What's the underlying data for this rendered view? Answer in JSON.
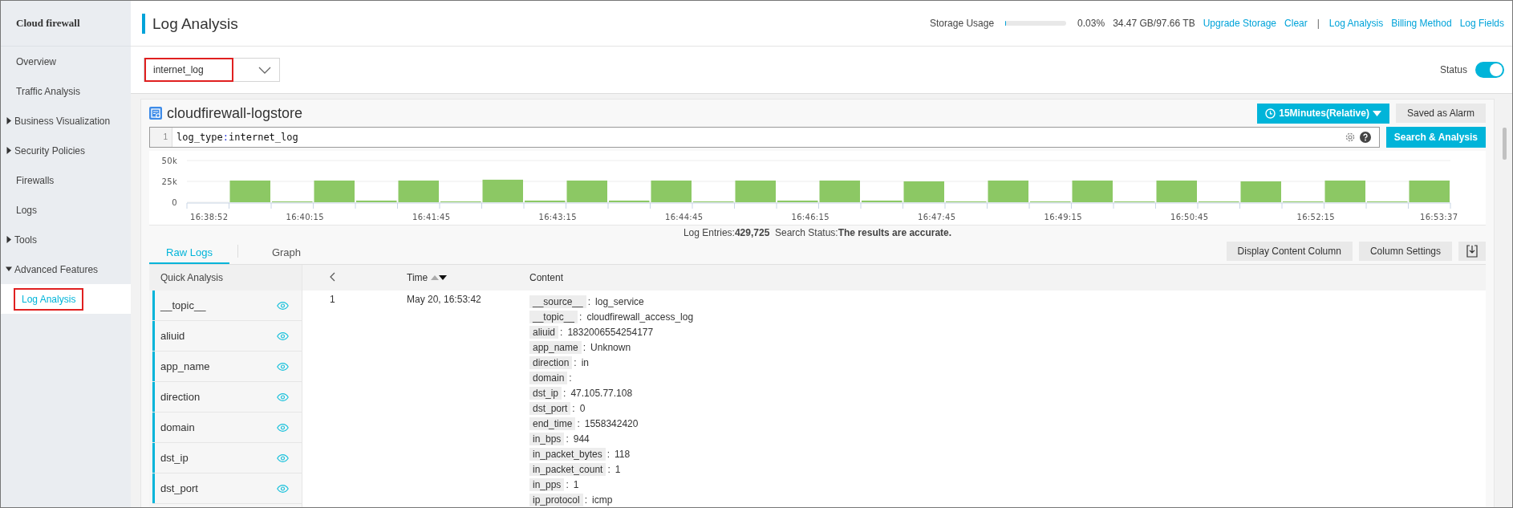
{
  "sidebar": {
    "title": "Cloud firewall",
    "items": [
      {
        "label": "Overview",
        "kind": "link",
        "selected": false
      },
      {
        "label": "Traffic Analysis",
        "kind": "link",
        "selected": false
      },
      {
        "label": "Business Visualization",
        "kind": "group",
        "expanded": false
      },
      {
        "label": "Security Policies",
        "kind": "group",
        "expanded": false
      },
      {
        "label": "Firewalls",
        "kind": "link",
        "selected": false
      },
      {
        "label": "Logs",
        "kind": "link",
        "selected": false
      },
      {
        "label": "Tools",
        "kind": "group",
        "expanded": false
      },
      {
        "label": "Advanced Features",
        "kind": "group",
        "expanded": true,
        "children": [
          {
            "label": "Log Analysis",
            "selected": true,
            "highlighted": true
          }
        ]
      }
    ]
  },
  "header": {
    "title": "Log Analysis",
    "storage": {
      "label": "Storage Usage",
      "level": 0.0003,
      "percent": "0.03%",
      "amount": "34.47 GB/97.66 TB"
    },
    "links": [
      {
        "kind": "link",
        "label": "Upgrade Storage"
      },
      {
        "kind": "link",
        "label": "Clear"
      },
      {
        "kind": "separator",
        "label": "|"
      },
      {
        "kind": "link",
        "label": "Log Analysis"
      },
      {
        "kind": "link",
        "label": "Billing Method"
      },
      {
        "kind": "link",
        "label": "Log Fields"
      }
    ]
  },
  "logstore_select": {
    "value": "internet_log",
    "highlighted": true
  },
  "status": {
    "label": "Status",
    "on": true
  },
  "card": {
    "logstore": "cloudfirewall-logstore",
    "time_range": "15Minutes(Relative)",
    "save_button": "Saved as Alarm",
    "query": {
      "line_number": "1",
      "key": "log_type",
      "separator": ":",
      "value": "internet_log"
    },
    "search_button": "Search & Analysis",
    "chart_data": {
      "type": "bar",
      "yticks": [
        {
          "value": 0,
          "label": "0"
        },
        {
          "value": 25000,
          "label": "25k"
        },
        {
          "value": 50000,
          "label": "50k"
        }
      ],
      "ylim": [
        0,
        50000
      ],
      "values": [
        0,
        26000,
        1000,
        26000,
        2000,
        26000,
        1000,
        27000,
        2000,
        26000,
        2000,
        26000,
        1000,
        26000,
        2000,
        26000,
        2000,
        25000,
        1000,
        26000,
        1000,
        26000,
        1000,
        26000,
        1000,
        25000,
        1000,
        26000,
        1000,
        26000
      ]
    },
    "time_axis_labels": [
      "16:38:52",
      "16:40:15",
      "16:41:45",
      "16:43:15",
      "16:44:45",
      "16:46:15",
      "16:47:45",
      "16:49:15",
      "16:50:45",
      "16:52:15",
      "16:53:37"
    ],
    "summary": {
      "entries_label": "Log Entries:",
      "entries": "429,725",
      "status_label": "Search Status:",
      "status": "The results are accurate."
    },
    "tabs": [
      {
        "label": "Raw Logs",
        "selected": true
      },
      {
        "label": "Graph",
        "selected": false
      }
    ],
    "buttons": [
      "Display Content Column",
      "Column Settings"
    ],
    "quick_analysis": {
      "title": "Quick Analysis",
      "fields": [
        "__topic__",
        "aliuid",
        "app_name",
        "direction",
        "domain",
        "dst_ip",
        "dst_port"
      ]
    },
    "table": {
      "columns": [
        "Time",
        "Content"
      ],
      "field_separator": ":",
      "rows": [
        {
          "index": "1",
          "time": "May 20, 16:53:42",
          "fields": [
            {
              "key": "__source__",
              "value": "log_service"
            },
            {
              "key": "__topic__",
              "value": "cloudfirewall_access_log"
            },
            {
              "key": "aliuid",
              "value": "1832006554254177"
            },
            {
              "key": "app_name",
              "value": "Unknown"
            },
            {
              "key": "direction",
              "value": "in"
            },
            {
              "key": "domain"
            },
            {
              "key": "dst_ip",
              "value": "47.105.77.108"
            },
            {
              "key": "dst_port",
              "value": "0"
            },
            {
              "key": "end_time",
              "value": "1558342420"
            },
            {
              "key": "in_bps",
              "value": "944"
            },
            {
              "key": "in_packet_bytes",
              "value": "118"
            },
            {
              "key": "in_packet_count",
              "value": "1"
            },
            {
              "key": "in_pps",
              "value": "1"
            },
            {
              "key": "ip_protocol",
              "value": "icmp"
            }
          ]
        }
      ]
    }
  }
}
